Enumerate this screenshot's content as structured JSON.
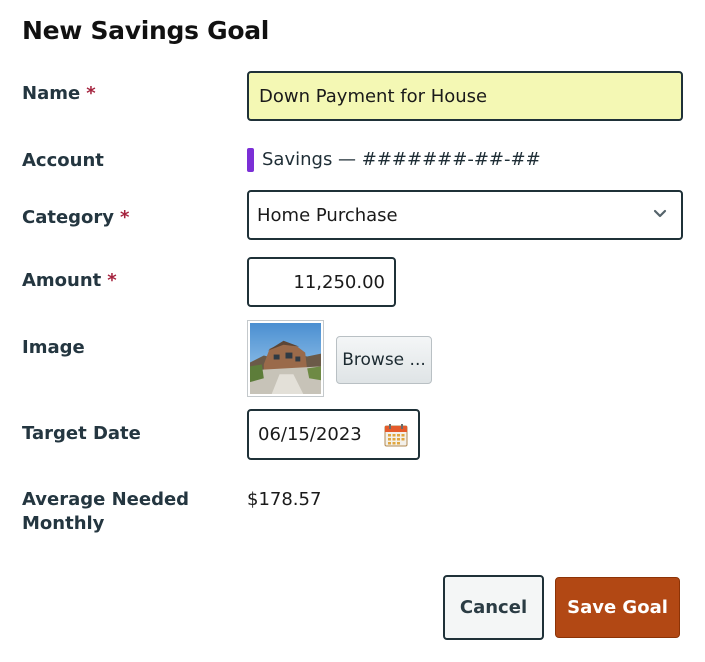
{
  "dialog": {
    "title": "New Savings Goal"
  },
  "fields": {
    "name": {
      "label": "Name",
      "required_mark": "*",
      "value": "Down Payment for House"
    },
    "account": {
      "label": "Account",
      "value": "Savings — #######-##-##",
      "marker_color": "#7b2fd6"
    },
    "category": {
      "label": "Category",
      "required_mark": "*",
      "selected": "Home Purchase"
    },
    "amount": {
      "label": "Amount",
      "required_mark": "*",
      "value": "11,250.00"
    },
    "image": {
      "label": "Image",
      "browse_label": "Browse ..."
    },
    "target_date": {
      "label": "Target Date",
      "value": "06/15/2023"
    },
    "average_needed": {
      "label_line1": "Average Needed",
      "label_line2": "Monthly",
      "value": "$178.57"
    }
  },
  "buttons": {
    "cancel": "Cancel",
    "save": "Save Goal"
  },
  "icons": {
    "category_dropdown": "chevron-down-icon",
    "date_picker": "calendar-icon"
  },
  "colors": {
    "save_button": "#b24814",
    "name_field_bg": "#f4f8b4",
    "required": "#a5233e"
  }
}
